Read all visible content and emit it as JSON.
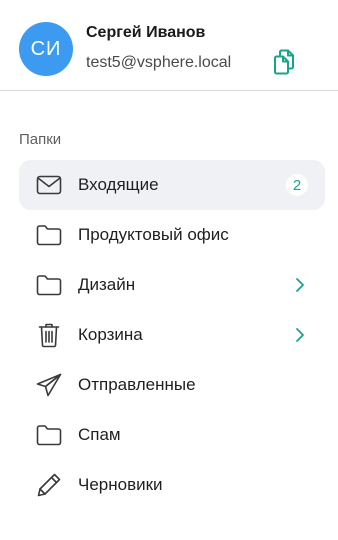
{
  "account": {
    "initials": "СИ",
    "name": "Сергей Иванов",
    "email": "test5@vsphere.local",
    "avatar_color": "#3c9bf0",
    "copy_icon": "copy-icon",
    "copy_icon_color": "#17a58a"
  },
  "folders": {
    "title": "Папки",
    "items": [
      {
        "label": "Входящие",
        "icon": "mail-icon",
        "badge": "2",
        "active": true
      },
      {
        "label": "Продуктовый офис",
        "icon": "folder-icon"
      },
      {
        "label": "Дизайн",
        "icon": "folder-icon",
        "expandable": true
      },
      {
        "label": "Корзина",
        "icon": "trash-icon",
        "expandable": true
      },
      {
        "label": "Отправленные",
        "icon": "send-icon"
      },
      {
        "label": "Спам",
        "icon": "folder-icon"
      },
      {
        "label": "Черновики",
        "icon": "pencil-icon"
      }
    ]
  },
  "colors": {
    "accent": "#17a58a",
    "active_row": "#f0f1f4",
    "divider": "#d9d9d9"
  }
}
